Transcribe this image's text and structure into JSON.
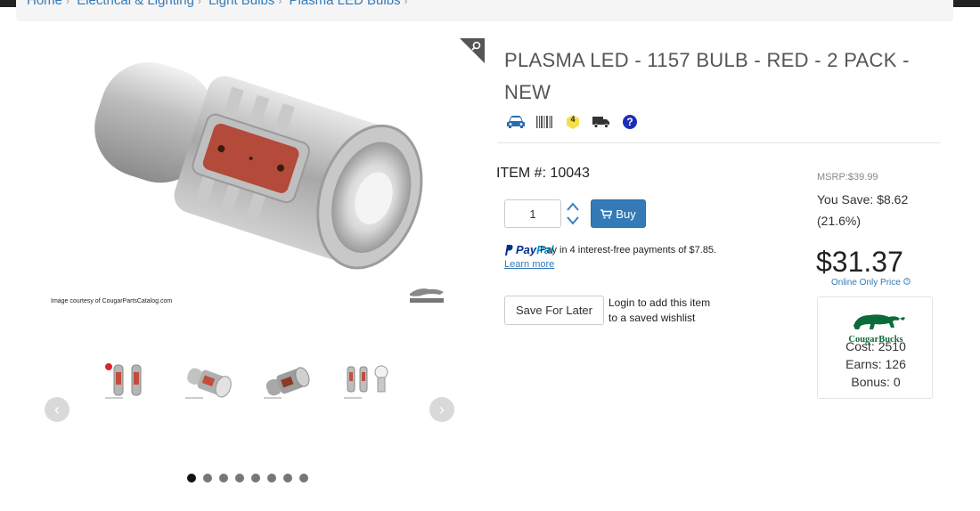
{
  "breadcrumb": {
    "items": [
      "Home",
      "Electrical & Lighting",
      "Light Bulbs",
      "Plasma LED Bulbs"
    ],
    "sep": "›"
  },
  "image": {
    "courtesy": "Image courtesy of CougarPartsCatalog.com"
  },
  "carousel": {
    "dot_count": 8,
    "active_index": 0,
    "prev_glyph": "‹",
    "next_glyph": "›"
  },
  "product": {
    "title": "PLASMA LED - 1157 BULB - RED - 2 PACK - NEW",
    "icons": [
      "car-icon",
      "barcode-icon",
      "rank-badge-icon",
      "truck-icon",
      "help-icon"
    ],
    "rank_badge": "4",
    "item_label": "ITEM #: 10043",
    "quantity": "1",
    "buy_label": "Buy",
    "paypal": {
      "logo_1": "Pay",
      "logo_2": "Pal",
      "text": "Pay in 4 interest-free payments of $7.85.",
      "learn_more": "Learn more"
    },
    "save_later_label": "Save For Later",
    "login_note_1": "Login to add this item",
    "login_note_2": "to a saved wishlist"
  },
  "pricing": {
    "msrp": "MSRP:$39.99",
    "you_save": "You Save: $8.62",
    "you_save_pct": "(21.6%)",
    "price": "$31.37",
    "online_only": "Online Only Price"
  },
  "cougar_bucks": {
    "logo_text": "CougarBucks",
    "cost": "Cost: 2510",
    "earns": "Earns: 126",
    "bonus": "Bonus: 0"
  },
  "colors": {
    "link": "#337ab7",
    "buy": "#337ab7",
    "cougar_green": "#0b6b3a",
    "paypal_dark": "#003087",
    "paypal_light": "#009cde"
  }
}
